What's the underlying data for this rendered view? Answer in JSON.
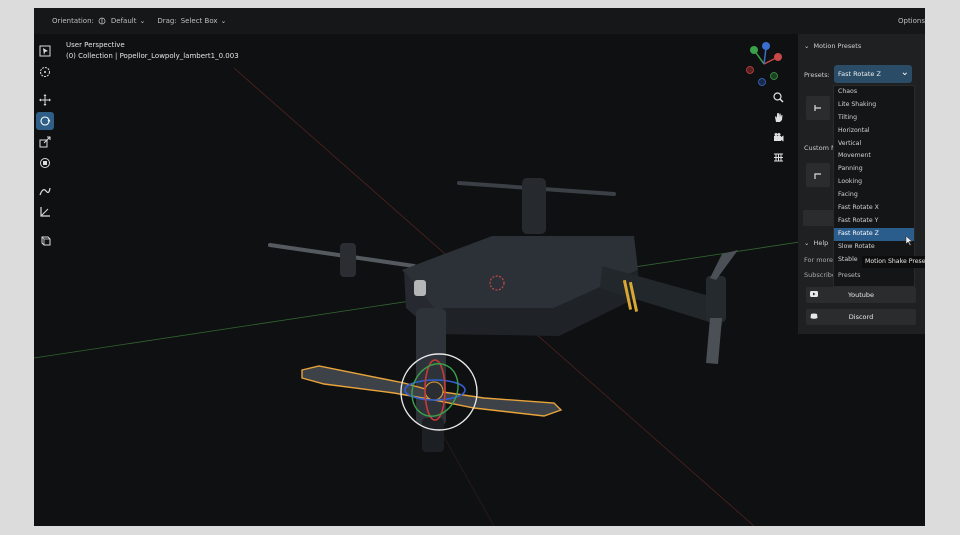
{
  "header": {
    "orientation_label": "Orientation:",
    "orientation_value": "Default",
    "drag_label": "Drag:",
    "drag_value": "Select Box",
    "options_label": "Options"
  },
  "viewport": {
    "perspective": "User Perspective",
    "collection": "(0) Collection | Popellor_Lowpoly_lambert1_0.003"
  },
  "toolbar": {
    "tools": [
      "select-icon",
      "cursor-icon",
      "move-icon",
      "rotate-icon",
      "scale-icon",
      "transform-icon",
      "annotate-icon",
      "measure-icon",
      "add-cube-icon"
    ],
    "active_tool": "rotate-icon"
  },
  "nav": {
    "icons": [
      "zoom-icon",
      "hand-pan-icon",
      "camera-icon",
      "grid-icon"
    ],
    "gizmo_axes": [
      "X",
      "Y",
      "Z"
    ]
  },
  "panel": {
    "title": "Motion Presets",
    "presets_label": "Presets:",
    "presets_value": "Fast Rotate Z",
    "custom_label": "Custom M",
    "help_label": "Help",
    "more_text": "For more i",
    "subscribe_text": "Subscribe",
    "youtube_label": "Youtube",
    "discord_label": "Discord"
  },
  "dropdown": {
    "items": [
      "Chaos",
      "Lite Shaking",
      "Tilting",
      "Horizontal",
      "Vertical",
      "Movement",
      "Panning",
      "Looking",
      "Facing",
      "Fast Rotate X",
      "Fast Rotate Y",
      "Fast Rotate Z",
      "Slow Rotate",
      "Stable"
    ],
    "selected": "Fast Rotate Z",
    "section_label": "Presets"
  },
  "tooltip": "Motion Shake Preset",
  "colors": {
    "accent": "#2f5f86",
    "selected_item": "#2b5d8c",
    "x_axis": "#b53a3a",
    "y_axis": "#3a8a3a",
    "selection_outline": "#e8a33a"
  }
}
